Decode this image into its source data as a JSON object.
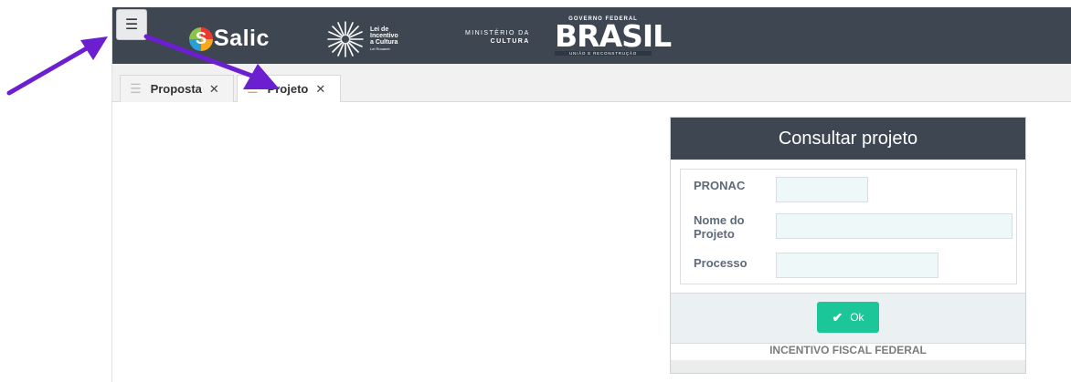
{
  "header": {
    "menu_icon": "hamburger-icon",
    "salic_logo_text": "Salic",
    "rouanet_logo": [
      "Lei de",
      "Incentivo",
      "a Cultura",
      "Lei Rouanet"
    ],
    "ministerio": [
      "MINISTÉRIO DA",
      "CULTURA"
    ],
    "governo": {
      "top": "GOVERNO FEDERAL",
      "main": "BRASIL",
      "bottom": "UNIÃO E RECONSTRUÇÃO"
    }
  },
  "tabs": [
    {
      "label": "Proposta",
      "icon": "sliders-icon",
      "close": "✕",
      "active": false
    },
    {
      "label": "Projeto",
      "icon": "sliders-icon",
      "close": "✕",
      "active": true
    }
  ],
  "panel": {
    "title": "Consultar projeto",
    "fields": [
      {
        "label": "PRONAC",
        "value": ""
      },
      {
        "label": "Nome do Projeto",
        "value": ""
      },
      {
        "label": "Processo",
        "value": ""
      }
    ],
    "ok_label": "Ok",
    "footer": "INCENTIVO FISCAL FEDERAL"
  },
  "colors": {
    "header_bg": "#3e4651",
    "ok_button": "#1bc798",
    "annotation_arrow": "#6b1fd0"
  }
}
